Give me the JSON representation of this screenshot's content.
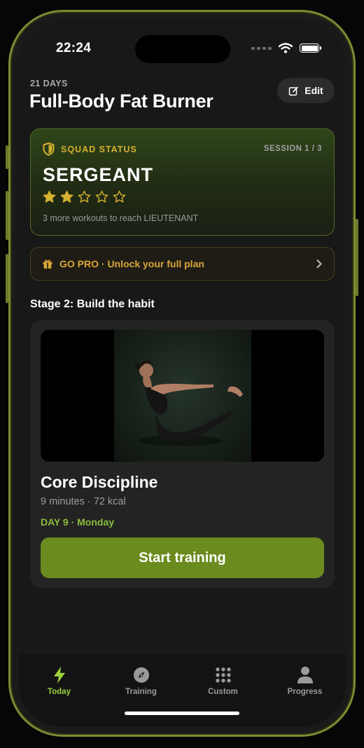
{
  "status_bar": {
    "time": "22:24"
  },
  "plan": {
    "duration": "21 DAYS",
    "title": "Full-Body Fat Burner",
    "edit_label": "Edit"
  },
  "squad": {
    "label": "SQUAD STATUS",
    "session": "SESSION 1 / 3",
    "rank": "SERGEANT",
    "stars_filled": 2,
    "stars_total": 5,
    "progress_note": "3 more workouts to reach LIEUTENANT"
  },
  "promo": {
    "text": "GO PRO · Unlock your full plan"
  },
  "stage": {
    "title": "Stage 2: Build the habit"
  },
  "workout": {
    "title": "Core Discipline",
    "meta": "9 minutes · 72 kcal",
    "day": "DAY 9 · Monday",
    "cta": "Start training"
  },
  "tabs": [
    {
      "label": "Today",
      "icon": "bolt-icon",
      "active": true
    },
    {
      "label": "Training",
      "icon": "compass-icon",
      "active": false
    },
    {
      "label": "Custom",
      "icon": "grid-icon",
      "active": false
    },
    {
      "label": "Progress",
      "icon": "person-icon",
      "active": false
    }
  ],
  "colors": {
    "accent_green": "#6b8b1e",
    "gold": "#d4b12e",
    "tab_active": "#9bd13a"
  }
}
